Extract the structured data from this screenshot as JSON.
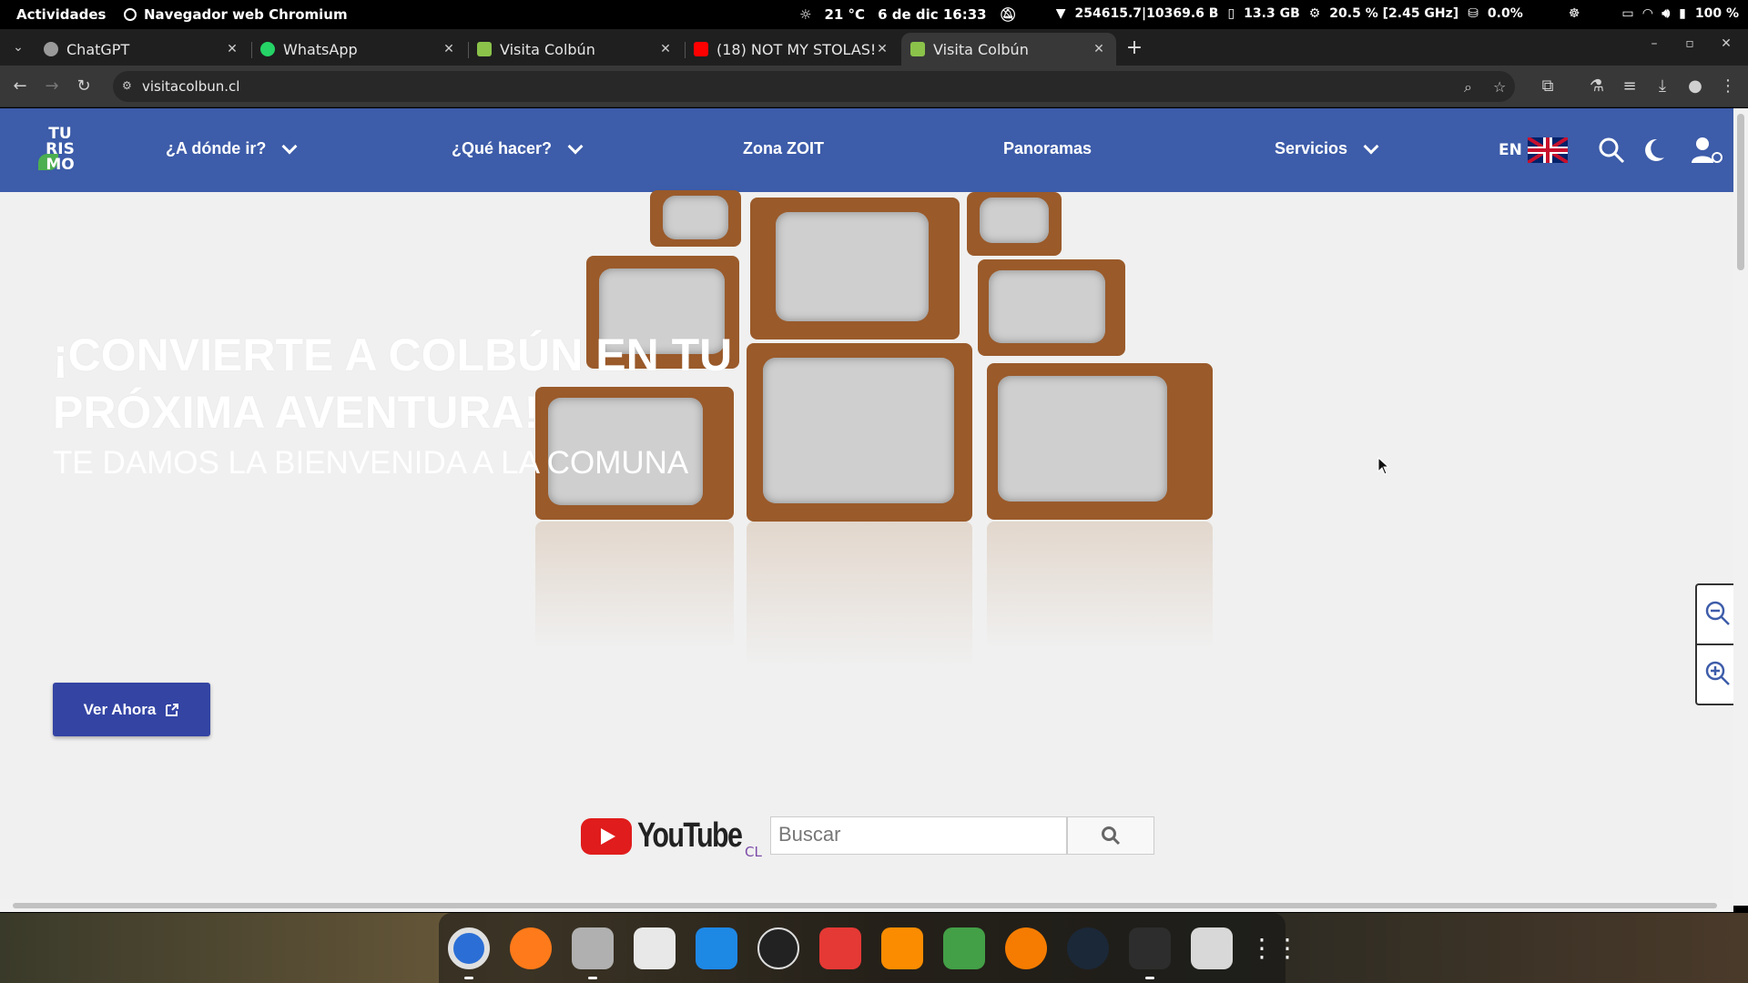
{
  "topbar": {
    "activities": "Actividades",
    "app_name": "Navegador web Chromium",
    "weather": "21 °C",
    "datetime": "6 de dic  16:33",
    "network": "254615.7|10369.6 B",
    "memory": "13.3 GB",
    "cpu": "20.5 % [2.45 GHz]",
    "disk": "0.0%",
    "battery": "100 %"
  },
  "tabs": [
    {
      "title": "ChatGPT",
      "favicon_color": "#9a9a9a",
      "active": false
    },
    {
      "title": "WhatsApp",
      "favicon_color": "#25d366",
      "active": false
    },
    {
      "title": "Visita Colbún",
      "favicon_color": "#8bc34a",
      "active": false
    },
    {
      "title": "(18) NOT MY STOLAS!!",
      "favicon_color": "#ff0000",
      "active": false
    },
    {
      "title": "Visita Colbún",
      "favicon_color": "#8bc34a",
      "active": true
    }
  ],
  "toolbar": {
    "url": "visitacolbun.cl"
  },
  "site": {
    "brand_color": "#3d5ca9",
    "logo_text": [
      "TU",
      "RIS",
      "MO"
    ],
    "nav": [
      {
        "label": "¿A dónde ir?",
        "has_dropdown": true
      },
      {
        "label": "¿Qué hacer?",
        "has_dropdown": true
      },
      {
        "label": "Zona ZOIT",
        "has_dropdown": false
      },
      {
        "label": "Panoramas",
        "has_dropdown": false
      },
      {
        "label": "Servicios",
        "has_dropdown": true
      }
    ],
    "lang": "EN",
    "hero": {
      "title": "¡CONVIERTE A COLBÚN EN TU PRÓXIMA AVENTURA!",
      "subtitle": "TE DAMOS LA BIENVENIDA A LA COMUNA",
      "cta": "Ver Ahora"
    },
    "youtube": {
      "wordmark": "YouTube",
      "region": "CL",
      "placeholder": "Buscar"
    }
  }
}
